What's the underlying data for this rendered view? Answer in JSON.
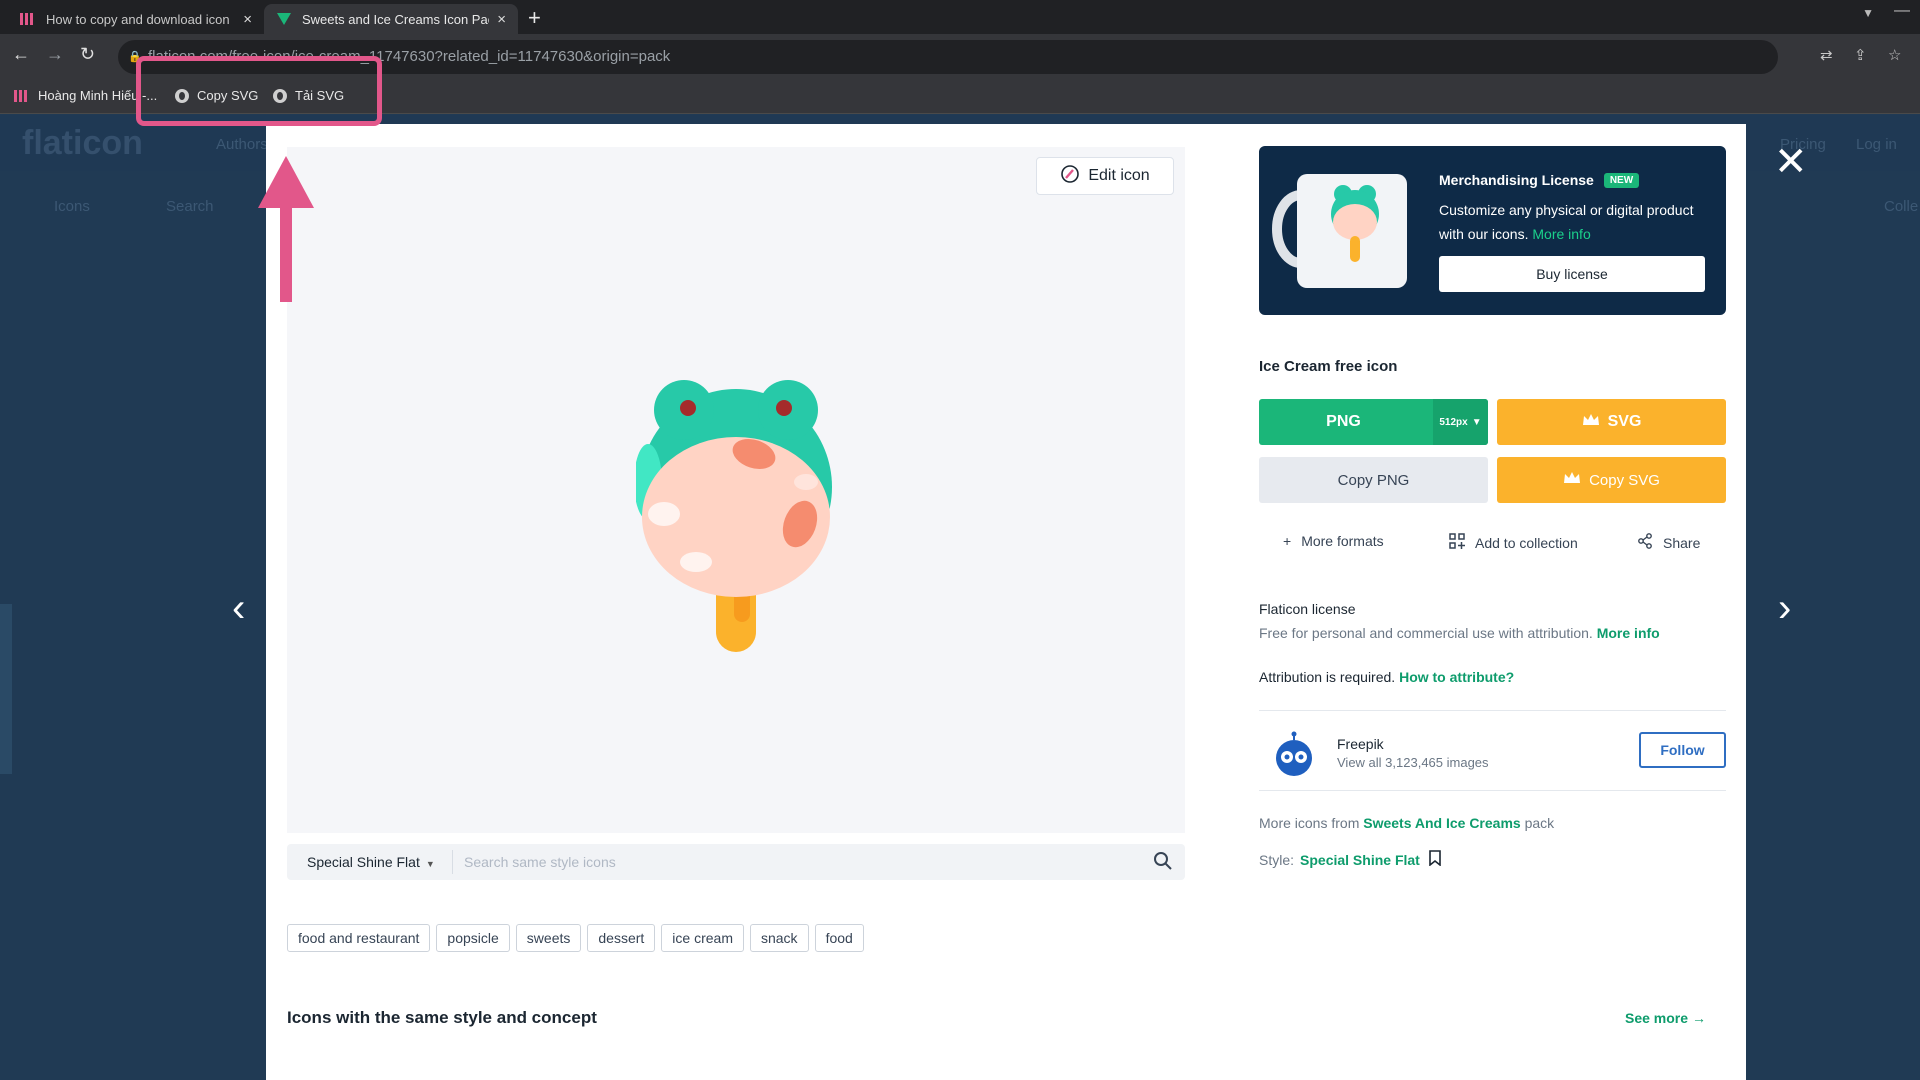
{
  "browser": {
    "tabs": [
      {
        "title": "How to copy and download icon",
        "close": "×"
      },
      {
        "title": "Sweets and Ice Creams Icon Pack",
        "close": "×"
      }
    ],
    "new_tab": "+",
    "url_dim": "flaticon.com/free-icon/ice-cream_",
    "url_main": "11747630?related_id=11747630&origin=pack",
    "bookmarks": [
      {
        "label": "Hoàng Minh Hiếu -..."
      },
      {
        "label": "Copy SVG"
      },
      {
        "label": "Tải SVG"
      }
    ]
  },
  "background": {
    "logo": "flaticon",
    "nav_authors": "Authors",
    "nav_pricing": "Pricing",
    "nav_login": "Log in",
    "search_category": "Icons",
    "search_placeholder": "Search",
    "collections": "Colle"
  },
  "modal": {
    "edit_label": "Edit icon",
    "style_select": "Special Shine Flat",
    "style_search_placeholder": "Search same style icons",
    "tags": [
      "food and restaurant",
      "popsicle",
      "sweets",
      "dessert",
      "ice cream",
      "snack",
      "food"
    ],
    "related_title": "Icons with the same style and concept",
    "see_more": "See more",
    "prev": "‹",
    "next": "›",
    "close": "✕"
  },
  "merch": {
    "title": "Merchandising License",
    "badge": "NEW",
    "desc": "Customize any physical or digital product with our icons.",
    "more": "More info",
    "buy": "Buy license"
  },
  "icon": {
    "title": "Ice Cream free icon",
    "png": "PNG",
    "size": "512px",
    "svg": "SVG",
    "copy_png": "Copy PNG",
    "copy_svg": "Copy SVG",
    "more_formats": "More formats",
    "add_collection": "Add to collection",
    "share": "Share"
  },
  "license": {
    "title": "Flaticon license",
    "desc": "Free for personal and commercial use with attribution.",
    "more": "More info",
    "attr_text": "Attribution is required.",
    "attr_link": "How to attribute?"
  },
  "author": {
    "name": "Freepik",
    "count": "View all 3,123,465 images",
    "follow": "Follow"
  },
  "pack": {
    "prefix": "More icons from",
    "name": "Sweets And Ice Creams",
    "suffix": "pack",
    "style_label": "Style:",
    "style_name": "Special Shine Flat"
  },
  "colors": {
    "green": "#1bb679",
    "orange": "#fbb22c",
    "navy": "#0e2a47",
    "highlight": "#e2578a"
  }
}
